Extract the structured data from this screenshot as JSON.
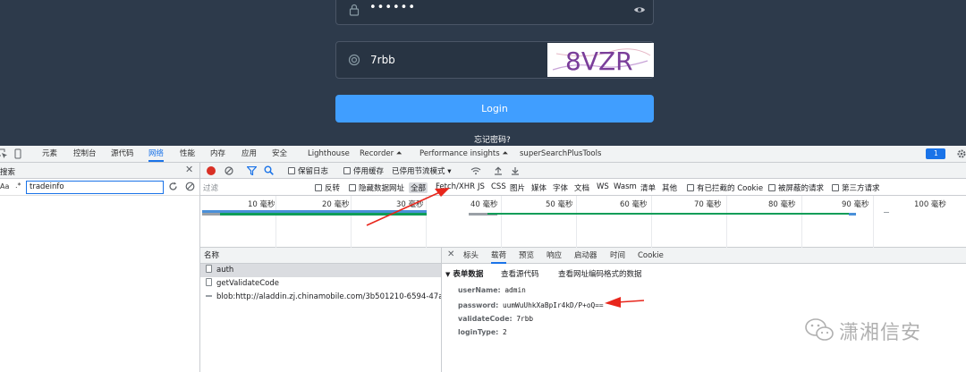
{
  "login": {
    "password_mask": "••••••",
    "captcha_input": "7rbb",
    "captcha_image_text": "8VZR",
    "login_label": "Login",
    "forgot_label": "忘记密码?"
  },
  "devtools": {
    "tabs": [
      "元素",
      "控制台",
      "源代码",
      "网络",
      "性能",
      "内存",
      "应用",
      "安全",
      "Lighthouse",
      "Recorder ⏶",
      "Performance insights ⏶",
      "superSearchPlusTools"
    ],
    "active_tab": "网络",
    "issues_badge": "1",
    "accent": "#1a73e8"
  },
  "search": {
    "title": "搜索",
    "aa_label": "Aa",
    "regex_label": ".*",
    "query": "tradeinfo"
  },
  "network_toolbar": {
    "preserve_log": "保留日志",
    "disable_cache": "停用缓存",
    "throttle": "已停用节流模式"
  },
  "filter_bar": {
    "placeholder": "过滤",
    "invert": "反转",
    "hide_data_urls": "隐藏数据网址",
    "types": [
      "全部",
      "Fetch/XHR",
      "JS",
      "CSS",
      "图片",
      "媒体",
      "字体",
      "文档",
      "WS",
      "Wasm",
      "清单",
      "其他"
    ],
    "blocked_cookies": "有已拦截的 Cookie",
    "blocked_requests": "被屏蔽的请求",
    "third_party": "第三方请求"
  },
  "timeline": {
    "ticks": [
      "10 毫秒",
      "20 毫秒",
      "30 毫秒",
      "40 毫秒",
      "50 毫秒",
      "60 毫秒",
      "70 毫秒",
      "80 毫秒",
      "90 毫秒",
      "100 毫秒"
    ]
  },
  "requests": {
    "header": "名称",
    "rows": [
      "auth",
      "getValidateCode",
      "blob:http://aladdin.zj.chinamobile.com/3b501210-6594-47a7-8..."
    ]
  },
  "detail": {
    "tabs": [
      "标头",
      "载荷",
      "预览",
      "响应",
      "启动器",
      "时间",
      "Cookie"
    ],
    "active_tab": "载荷",
    "section_title": "表单数据",
    "view_source": "查看源代码",
    "view_url_encoded": "查看网址编码格式的数据",
    "fields": [
      {
        "key": "userName:",
        "value": "admin"
      },
      {
        "key": "password:",
        "value": "uumWuUhkXaBpIr4kD/P+oQ=="
      },
      {
        "key": "validateCode:",
        "value": "7rbb"
      },
      {
        "key": "loginType:",
        "value": "2"
      }
    ]
  },
  "watermark": {
    "text": "潇湘信安"
  }
}
